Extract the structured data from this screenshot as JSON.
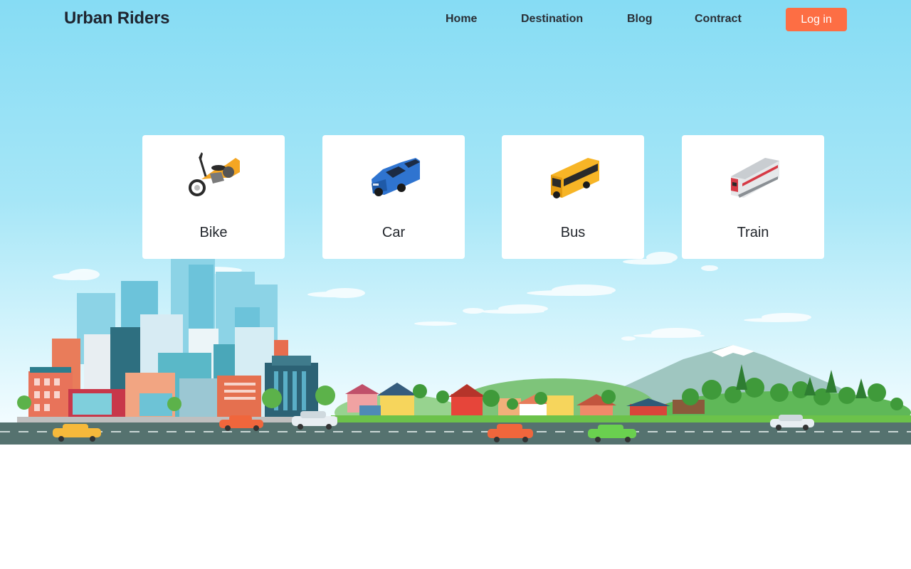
{
  "nav": {
    "brand": "Urban Riders",
    "links": [
      "Home",
      "Destination",
      "Blog",
      "Contract"
    ],
    "login_label": "Log in"
  },
  "vehicles": [
    {
      "label": "Bike",
      "icon": "motorbike-icon"
    },
    {
      "label": "Car",
      "icon": "car-icon"
    },
    {
      "label": "Bus",
      "icon": "bus-icon"
    },
    {
      "label": "Train",
      "icon": "train-icon"
    }
  ],
  "colors": {
    "sky_top": "#86dcf4",
    "login_button": "#fd6e44",
    "road": "#55726f",
    "card": "#ffffff"
  }
}
